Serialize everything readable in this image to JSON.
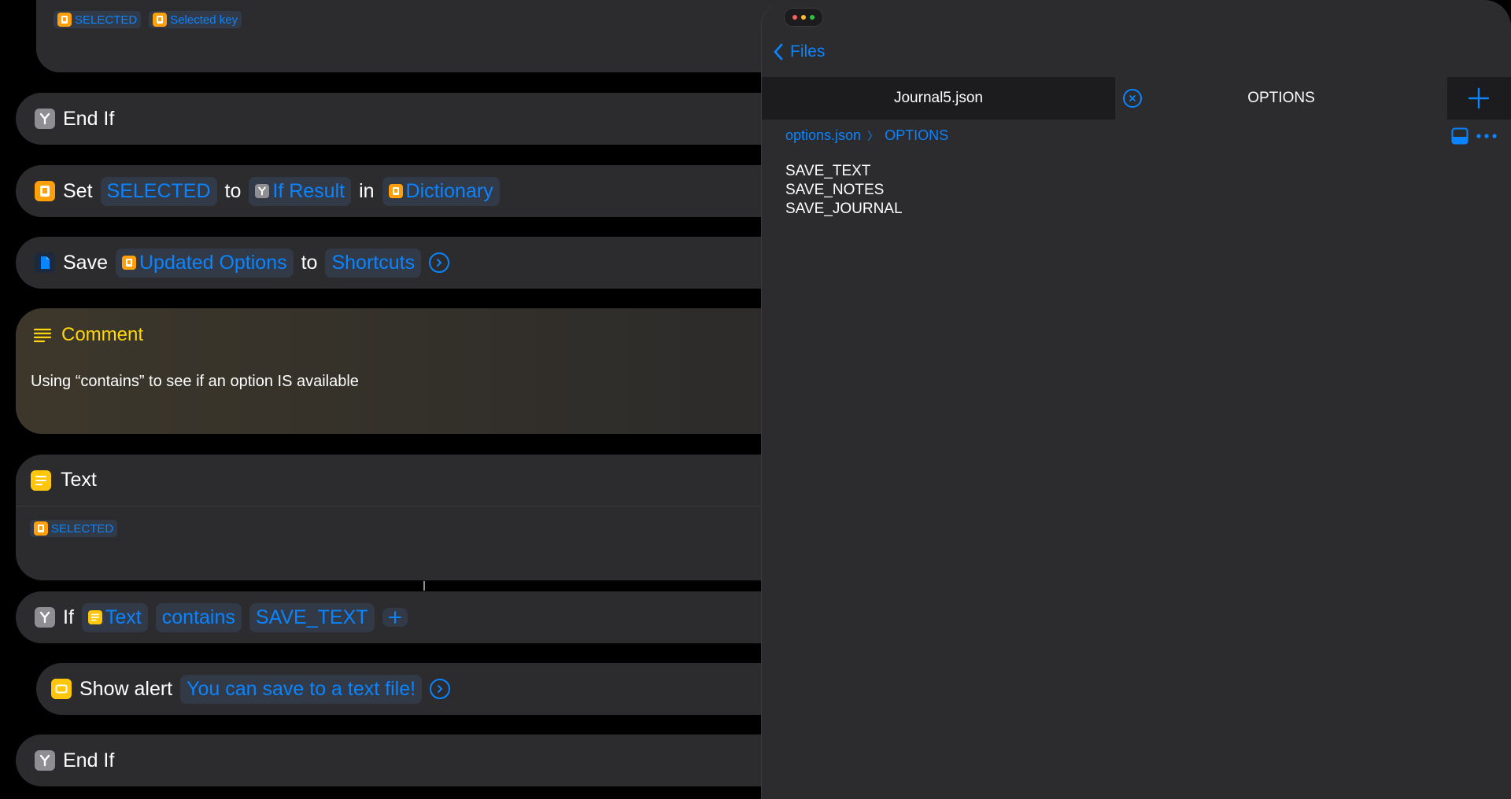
{
  "top_card": {
    "token1": "SELECTED",
    "token2": "Selected key"
  },
  "end_if_1": {
    "label": "End If"
  },
  "set_action": {
    "label": "Set",
    "variable": "SELECTED",
    "to": "to",
    "value": "If Result",
    "in": "in",
    "target": "Dictionary"
  },
  "save_action": {
    "label": "Save",
    "item": "Updated Options",
    "to": "to",
    "destination": "Shortcuts"
  },
  "comment": {
    "title": "Comment",
    "body": "Using “contains” to see if an option IS available"
  },
  "text_action": {
    "title": "Text",
    "token": "SELECTED"
  },
  "if_action": {
    "label": "If",
    "input": "Text",
    "condition": "contains",
    "value": "SAVE_TEXT"
  },
  "alert_action": {
    "label": "Show alert",
    "message": "You can save to a text file!"
  },
  "end_if_2": {
    "label": "End If"
  },
  "files_panel": {
    "back_label": "Files",
    "tabs": [
      {
        "label": "Journal5.json",
        "active": false
      },
      {
        "label": "OPTIONS",
        "active": true
      }
    ],
    "breadcrumb": {
      "file": "options.json",
      "separator": "〉",
      "key": "OPTIONS"
    },
    "content_lines": [
      "SAVE_TEXT",
      "SAVE_NOTES",
      "SAVE_JOURNAL"
    ]
  },
  "colors": {
    "accent": "#0a84ff",
    "comment_title": "#ffd60a",
    "card": "#2c2c2e",
    "token_bg": "#323a48"
  }
}
